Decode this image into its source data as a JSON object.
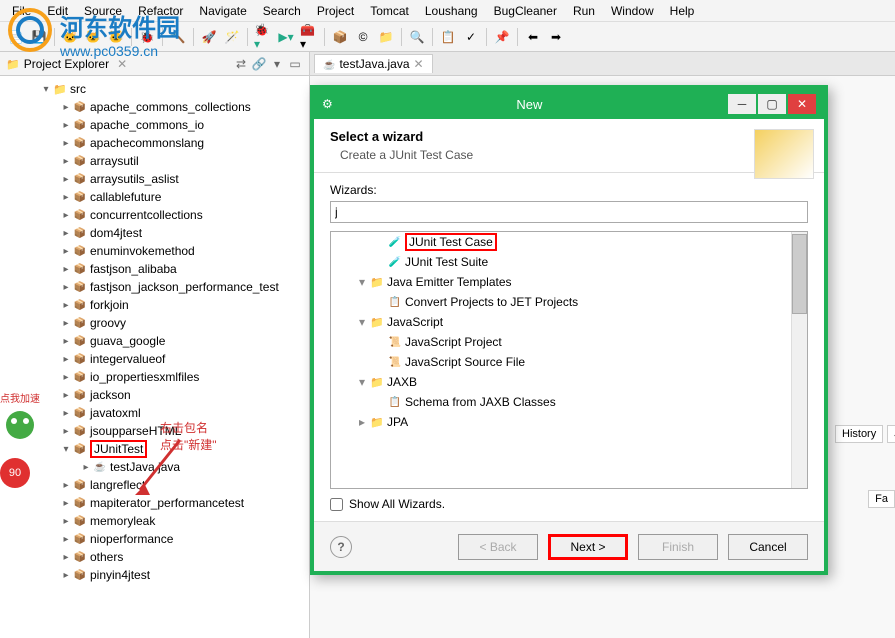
{
  "menubar": [
    "File",
    "Edit",
    "Source",
    "Refactor",
    "Navigate",
    "Search",
    "Project",
    "Tomcat",
    "Loushang",
    "BugCleaner",
    "Run",
    "Window",
    "Help"
  ],
  "watermark": {
    "text": "河东软件园",
    "url": "www.pc0359.cn"
  },
  "explorer": {
    "title": "Project Explorer",
    "src_label": "src",
    "packages": [
      "apache_commons_collections",
      "apache_commons_io",
      "apachecommonslang",
      "arraysutil",
      "arraysutils_aslist",
      "callablefuture",
      "concurrentcollections",
      "dom4jtest",
      "enuminvokemethod",
      "fastjson_alibaba",
      "fastjson_jackson_performance_test",
      "forkjoin",
      "groovy",
      "guava_google",
      "integervalueof",
      "io_propertiesxmlfiles",
      "jackson",
      "javatoxml",
      "jsoupparseHTML",
      "JUnitTest",
      "langreflect",
      "mapiterator_performancetest",
      "memoryleak",
      "nioperformance",
      "others",
      "pinyin4jtest"
    ],
    "java_file": "testJava.java",
    "highlighted_package": "JUnitTest"
  },
  "editor": {
    "tab_label": "testJava.java"
  },
  "dialog": {
    "title": "New",
    "header_title": "Select a wizard",
    "header_sub": "Create a JUnit Test Case",
    "wizards_label": "Wizards:",
    "filter_value": "j",
    "tree": [
      {
        "label": "JUnit Test Case",
        "depth": 2,
        "icon": "junit",
        "highlighted": true
      },
      {
        "label": "JUnit Test Suite",
        "depth": 2,
        "icon": "junit"
      },
      {
        "label": "Java Emitter Templates",
        "depth": 1,
        "icon": "folder",
        "toggle": "-"
      },
      {
        "label": "Convert Projects to JET Projects",
        "depth": 2,
        "icon": "schema"
      },
      {
        "label": "JavaScript",
        "depth": 1,
        "icon": "folder",
        "toggle": "-"
      },
      {
        "label": "JavaScript Project",
        "depth": 2,
        "icon": "js"
      },
      {
        "label": "JavaScript Source File",
        "depth": 2,
        "icon": "js"
      },
      {
        "label": "JAXB",
        "depth": 1,
        "icon": "folder",
        "toggle": "-"
      },
      {
        "label": "Schema from JAXB Classes",
        "depth": 2,
        "icon": "schema"
      },
      {
        "label": "JPA",
        "depth": 1,
        "icon": "folder",
        "toggle": "+"
      }
    ],
    "show_all": "Show All Wizards.",
    "buttons": {
      "back": "< Back",
      "next": "Next >",
      "finish": "Finish",
      "cancel": "Cancel"
    }
  },
  "annotation": {
    "line1": "右击包名",
    "line2": "点击\"新建\""
  },
  "right_tabs": {
    "history": "History",
    "ju": "JU",
    "fa": "Fa"
  },
  "badge": "90",
  "badge_text": "点我加速"
}
